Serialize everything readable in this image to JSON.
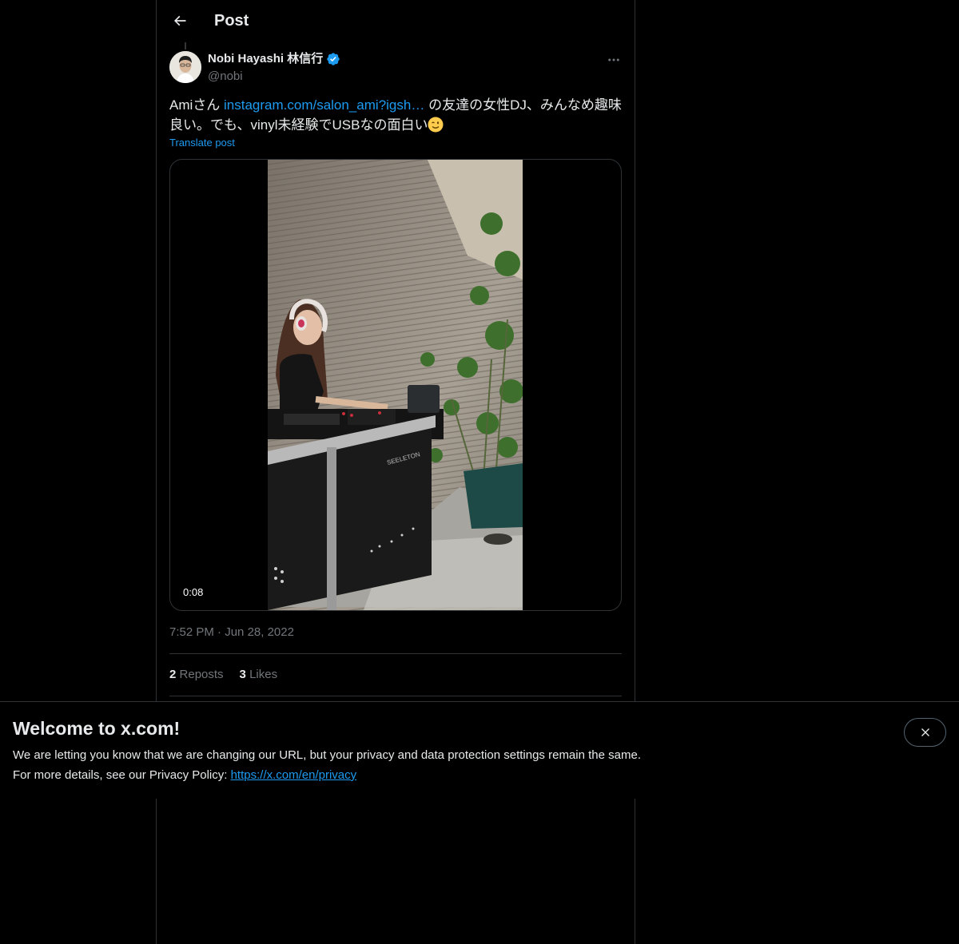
{
  "header": {
    "title": "Post",
    "back_icon": "arrow-left-icon"
  },
  "post": {
    "author": {
      "name": "Nobi Hayashi 林信行",
      "handle": "@nobi",
      "verified": true
    },
    "text_part1": "Amiさん ",
    "link_text": "instagram.com/salon_ami?igsh…",
    "text_part2": " の友達の女性DJ、みんなめ趣味良い。でも、vinyl未経験でUSBなの面白い",
    "emoji": "winking-face",
    "translate_label": "Translate post",
    "video": {
      "duration": "0:08"
    },
    "time": "7:52 PM",
    "separator": "·",
    "date": "Jun 28, 2022",
    "stats": {
      "reposts_count": "2",
      "reposts_label": "Reposts",
      "likes_count": "3",
      "likes_label": "Likes"
    }
  },
  "banner": {
    "title": "Welcome to x.com!",
    "line1": "We are letting you know that we are changing our URL, but your privacy and data protection settings remain the same.",
    "line2_prefix": "For more details, see our Privacy Policy: ",
    "link": "https://x.com/en/privacy"
  },
  "colors": {
    "background": "#000000",
    "accent": "#1d9bf0",
    "text_primary": "#e7e9ea",
    "text_secondary": "#71767b",
    "border": "#2f3336"
  }
}
